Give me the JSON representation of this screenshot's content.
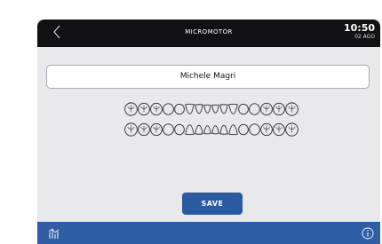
{
  "header": {
    "back_icon": "chevron-left-icon",
    "title": "MICROMOTOR",
    "time": "10:50",
    "date": "02 AGO"
  },
  "patient": {
    "name": "Michele Magri"
  },
  "dental_chart": {
    "upper_teeth_count": 16,
    "lower_teeth_count": 16
  },
  "actions": {
    "save_label": "SAVE"
  },
  "footer": {
    "left_icon": "stats-icon",
    "right_icon": "info-icon"
  },
  "colors": {
    "topbar": "#111114",
    "accent": "#2f5ea5",
    "background": "#e9e9ec"
  }
}
